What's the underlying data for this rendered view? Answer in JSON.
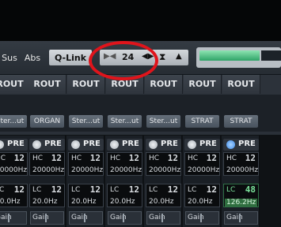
{
  "toolbar": {
    "sus_label": "Sus",
    "abs_label": "Abs",
    "qlink_label": "Q-Link",
    "channel_number": "24",
    "prev_icon": "skip-prev-icon",
    "next_icon": "skip-next-icon"
  },
  "meter": {
    "level": 0.75,
    "color": "#3fb97a"
  },
  "highlight_color": "#e0141b",
  "rout_label": "ROUT",
  "channels": [
    {
      "route": "Ster...ut",
      "pre": "PRE",
      "pre_active": false,
      "hc_label": "HC",
      "hc_value": "12",
      "hc_freq": "20000Hz",
      "lc_label": "LC",
      "lc_value": "12",
      "lc_freq": "20.0Hz",
      "gain": "Gain"
    },
    {
      "route": "ORGAN",
      "pre": "PRE",
      "pre_active": false,
      "hc_label": "HC",
      "hc_value": "12",
      "hc_freq": "20000Hz",
      "lc_label": "LC",
      "lc_value": "12",
      "lc_freq": "20.0Hz",
      "gain": "Gain"
    },
    {
      "route": "Ster...ut",
      "pre": "PRE",
      "pre_active": false,
      "hc_label": "HC",
      "hc_value": "12",
      "hc_freq": "20000Hz",
      "lc_label": "LC",
      "lc_value": "12",
      "lc_freq": "20.0Hz",
      "gain": "Gain"
    },
    {
      "route": "Ster...ut",
      "pre": "PRE",
      "pre_active": false,
      "hc_label": "HC",
      "hc_value": "12",
      "hc_freq": "20000Hz",
      "lc_label": "LC",
      "lc_value": "12",
      "lc_freq": "20.0Hz",
      "gain": "Gain"
    },
    {
      "route": "Ster...ut",
      "pre": "PRE",
      "pre_active": false,
      "hc_label": "HC",
      "hc_value": "12",
      "hc_freq": "20000Hz",
      "lc_label": "LC",
      "lc_value": "12",
      "lc_freq": "20.0Hz",
      "gain": "Gain"
    },
    {
      "route": "STRAT",
      "pre": "PRE",
      "pre_active": false,
      "hc_label": "HC",
      "hc_value": "12",
      "hc_freq": "20000Hz",
      "lc_label": "LC",
      "lc_value": "12",
      "lc_freq": "20.0Hz",
      "gain": "Gain"
    },
    {
      "route": "STRAT",
      "pre": "PRE",
      "pre_active": true,
      "hc_label": "HC",
      "hc_value": "12",
      "hc_freq": "20000Hz",
      "lc_label": "LC",
      "lc_value": "48",
      "lc_freq": "126.2Hz",
      "lc_active": true,
      "gain": "Gain"
    }
  ]
}
